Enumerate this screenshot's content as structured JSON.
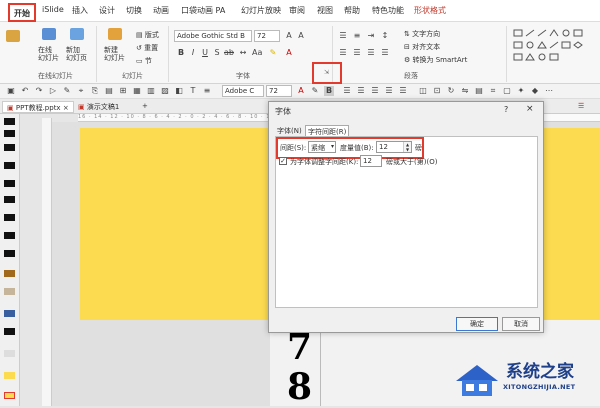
{
  "ribbon_tabs": [
    "开始",
    "iSlide",
    "插入",
    "设计",
    "切换",
    "动画",
    "口袋动画 PA",
    "幻灯片放映",
    "审阅",
    "视图",
    "帮助",
    "特色功能",
    "形状格式"
  ],
  "ribbon": {
    "new_slide": "新建\n幻灯片",
    "layout": "版式",
    "reset": "重置",
    "section": "节",
    "online_slides": "在线\n幻灯片",
    "new_page": "新加\n幻灯页",
    "group_online": "在线幻灯片",
    "group_slides": "幻灯片",
    "font_name": "Adobe Gothic Std B",
    "font_size": "72",
    "group_font": "字体",
    "text_direction": "文字方向",
    "align_text": "对齐文本",
    "smartart": "转换为 SmartArt",
    "group_paragraph": "段落",
    "qa_font": "Adobe C",
    "qa_size": "72"
  },
  "doc_tabs": [
    "PPT教程.pptx",
    "演示文稿1"
  ],
  "dialog": {
    "title": "字体",
    "help": "?",
    "close": "×",
    "tab_font": "字体(N)",
    "tab_spacing": "字符间距(R)",
    "spacing_label": "间距(S):",
    "spacing_value": "紧缩",
    "measure_label": "度量值(B):",
    "measure_value": "12",
    "measure_unit": "磅",
    "kerning_label": "为字体调整字间距(K):",
    "kerning_value": "12",
    "kerning_suffix": "磅或大于(第)(O)",
    "kerning_checked": "✓",
    "ok": "确定",
    "cancel": "取消"
  },
  "slide_numbers": [
    "7",
    "8"
  ],
  "ruler_marks": "16 · 14 · 12 · 10 · 8 · 6 · 4 · 2 · 0 · 2 · 4 · 6 · 8 · 10 · 12 · 14 · 16",
  "watermark": {
    "title": "系统之家",
    "url": "XITONGZHIJIA.NET"
  },
  "colors": {
    "highlight": "#e23b2e",
    "slide_bg": "#fcdb50",
    "brand": "#1e3f8a"
  }
}
